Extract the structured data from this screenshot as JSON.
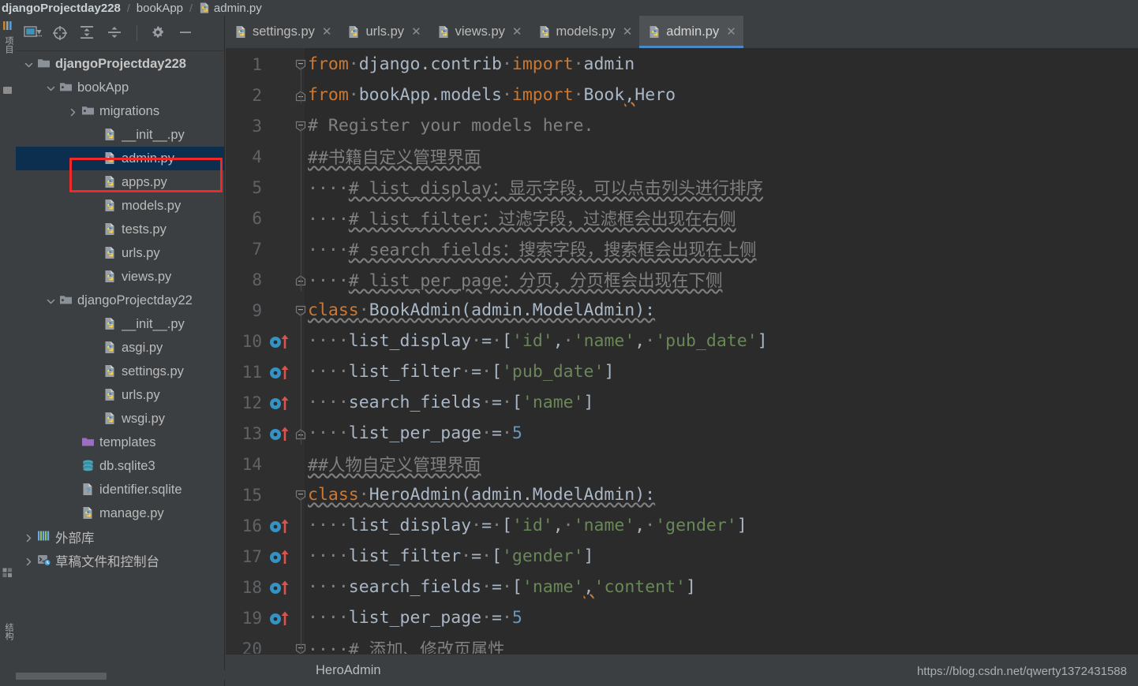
{
  "breadcrumb": {
    "segments": [
      "djangoProjectday228",
      "bookApp",
      "admin.py"
    ],
    "separator": "/"
  },
  "left_strip": {
    "top_label": "项目",
    "bottom_label": "结构"
  },
  "project_panel": {
    "toolbar": [
      {
        "name": "select-opened-file-icon",
        "label": "Select Opened File"
      },
      {
        "name": "locate-icon",
        "label": "Locate"
      },
      {
        "name": "expand-all-icon",
        "label": "Expand All"
      },
      {
        "name": "collapse-all-icon",
        "label": "Collapse All"
      },
      {
        "name": "gear-icon",
        "label": "Settings"
      },
      {
        "name": "hide-icon",
        "label": "Hide"
      }
    ],
    "tree": [
      {
        "label": "djangoProjectday228",
        "indent": 0,
        "arrow": "down",
        "icon": "folder-root",
        "bold": true,
        "selected": false
      },
      {
        "label": "bookApp",
        "indent": 1,
        "arrow": "down",
        "icon": "folder-module",
        "bold": false,
        "selected": false
      },
      {
        "label": "migrations",
        "indent": 2,
        "arrow": "right",
        "icon": "folder-module",
        "bold": false,
        "selected": false
      },
      {
        "label": "__init__.py",
        "indent": 3,
        "arrow": "none",
        "icon": "python-file",
        "bold": false,
        "selected": false
      },
      {
        "label": "admin.py",
        "indent": 3,
        "arrow": "none",
        "icon": "python-file",
        "bold": false,
        "selected": true
      },
      {
        "label": "apps.py",
        "indent": 3,
        "arrow": "none",
        "icon": "python-file",
        "bold": false,
        "selected": false
      },
      {
        "label": "models.py",
        "indent": 3,
        "arrow": "none",
        "icon": "python-file",
        "bold": false,
        "selected": false
      },
      {
        "label": "tests.py",
        "indent": 3,
        "arrow": "none",
        "icon": "python-file",
        "bold": false,
        "selected": false
      },
      {
        "label": "urls.py",
        "indent": 3,
        "arrow": "none",
        "icon": "python-file",
        "bold": false,
        "selected": false
      },
      {
        "label": "views.py",
        "indent": 3,
        "arrow": "none",
        "icon": "python-file",
        "bold": false,
        "selected": false
      },
      {
        "label": "djangoProjectday22",
        "indent": 1,
        "arrow": "down",
        "icon": "folder-module",
        "bold": false,
        "selected": false
      },
      {
        "label": "__init__.py",
        "indent": 3,
        "arrow": "none",
        "icon": "python-file",
        "bold": false,
        "selected": false
      },
      {
        "label": "asgi.py",
        "indent": 3,
        "arrow": "none",
        "icon": "python-file",
        "bold": false,
        "selected": false
      },
      {
        "label": "settings.py",
        "indent": 3,
        "arrow": "none",
        "icon": "python-file",
        "bold": false,
        "selected": false
      },
      {
        "label": "urls.py",
        "indent": 3,
        "arrow": "none",
        "icon": "python-file",
        "bold": false,
        "selected": false
      },
      {
        "label": "wsgi.py",
        "indent": 3,
        "arrow": "none",
        "icon": "python-file",
        "bold": false,
        "selected": false
      },
      {
        "label": "templates",
        "indent": 2,
        "arrow": "none",
        "icon": "folder-templates",
        "bold": false,
        "selected": false
      },
      {
        "label": "db.sqlite3",
        "indent": 2,
        "arrow": "none",
        "icon": "database",
        "bold": false,
        "selected": false
      },
      {
        "label": "identifier.sqlite",
        "indent": 2,
        "arrow": "none",
        "icon": "unknown-file",
        "bold": false,
        "selected": false
      },
      {
        "label": "manage.py",
        "indent": 2,
        "arrow": "none",
        "icon": "python-file",
        "bold": false,
        "selected": false
      },
      {
        "label": "外部库",
        "indent": 0,
        "arrow": "right",
        "icon": "library",
        "bold": false,
        "selected": false
      },
      {
        "label": "草稿文件和控制台",
        "indent": 0,
        "arrow": "right",
        "icon": "scratches",
        "bold": false,
        "selected": false
      }
    ],
    "annotation": {
      "name": "red-highlight-box",
      "color": "#ef2929",
      "target": "admin.py"
    }
  },
  "editor": {
    "tabs": [
      {
        "label": "settings.py",
        "active": false,
        "icon": "python-file"
      },
      {
        "label": "urls.py",
        "active": false,
        "icon": "python-file"
      },
      {
        "label": "views.py",
        "active": false,
        "icon": "python-file"
      },
      {
        "label": "models.py",
        "active": false,
        "icon": "python-file"
      },
      {
        "label": "admin.py",
        "active": true,
        "icon": "python-file"
      }
    ],
    "close_glyph": "✕",
    "active_tab_underline": "#4a88c7",
    "lines": [
      {
        "n": "1",
        "gutter": "none",
        "fold": "fold-start",
        "html": "<span class=\"kw\">from</span><span class=\"cm\">·</span>django.contrib<span class=\"cm\">·</span><span class=\"kw\">import</span><span class=\"cm\">·</span>admin",
        "text": "from django.contrib import admin"
      },
      {
        "n": "2",
        "gutter": "none",
        "fold": "fold-end",
        "html": "<span class=\"kw\">from</span><span class=\"cm\">·</span>bookApp.models<span class=\"cm\">·</span><span class=\"kw\">import</span><span class=\"cm\">·</span>Book<span class=\"wavy-o\">,</span>Hero",
        "text": "from bookApp.models import Book,Hero"
      },
      {
        "n": "3",
        "gutter": "none",
        "fold": "fold-start",
        "html": "<span class=\"cm\"># Register your models here.</span>",
        "text": "# Register your models here."
      },
      {
        "n": "4",
        "gutter": "none",
        "fold": "none",
        "html": "<span class=\"cm wavy\">##书籍自定义管理界面</span>",
        "text": "##书籍自定义管理界面"
      },
      {
        "n": "5",
        "gutter": "none",
        "fold": "none",
        "html": "<span class=\"cm\">····</span><span class=\"cm wavy\"># list_display：显示字段，可以点击列头进行排序</span>",
        "text": "    # list_display：显示字段，可以点击列头进行排序"
      },
      {
        "n": "6",
        "gutter": "none",
        "fold": "none",
        "html": "<span class=\"cm\">····</span><span class=\"cm wavy\"># list_filter：过滤字段，过滤框会出现在右侧</span>",
        "text": "    # list_filter：过滤字段，过滤框会出现在右侧"
      },
      {
        "n": "7",
        "gutter": "none",
        "fold": "none",
        "html": "<span class=\"cm\">····</span><span class=\"cm wavy\"># search_fields：搜索字段，搜索框会出现在上侧</span>",
        "text": "    # search_fields：搜索字段，搜索框会出现在上侧"
      },
      {
        "n": "8",
        "gutter": "none",
        "fold": "fold-end",
        "html": "<span class=\"cm\">····</span><span class=\"cm wavy\"># list_per_page：分页，分页框会出现在下侧</span>",
        "text": "    # list_per_page：分页，分页框会出现在下侧"
      },
      {
        "n": "9",
        "gutter": "none",
        "fold": "fold-start",
        "html": "<span class=\"kw wavy\">class</span><span class=\"cm wavy\">·</span><span class=\"def wavy\">BookAdmin(admin.ModelAdmin):</span>",
        "text": "class BookAdmin(admin.ModelAdmin):"
      },
      {
        "n": "10",
        "gutter": "overridden-marker",
        "fold": "none",
        "html": "<span class=\"cm\">····</span>list_display<span class=\"cm\">·</span>=<span class=\"cm\">·</span>[<span class=\"str\">'id'</span>,<span class=\"cm\">·</span><span class=\"str\">'name'</span>,<span class=\"cm\">·</span><span class=\"str\">'pub_date'</span>]",
        "text": "    list_display = ['id', 'name', 'pub_date']"
      },
      {
        "n": "11",
        "gutter": "overridden-marker",
        "fold": "none",
        "html": "<span class=\"cm\">····</span>list_filter<span class=\"cm\">·</span>=<span class=\"cm\">·</span>[<span class=\"str\">'pub_date'</span>]",
        "text": "    list_filter = ['pub_date']"
      },
      {
        "n": "12",
        "gutter": "overridden-marker",
        "fold": "none",
        "html": "<span class=\"cm\">····</span>search_fields<span class=\"cm\">·</span>=<span class=\"cm\">·</span>[<span class=\"str\">'name'</span>]",
        "text": "    search_fields = ['name']"
      },
      {
        "n": "13",
        "gutter": "overridden-marker",
        "fold": "fold-end",
        "html": "<span class=\"cm\">····</span>list_per_page<span class=\"cm\">·</span>=<span class=\"cm\">·</span><span class=\"num\">5</span>",
        "text": "    list_per_page = 5"
      },
      {
        "n": "14",
        "gutter": "none",
        "fold": "none",
        "html": "<span class=\"cm wavy\">##人物自定义管理界面</span>",
        "text": "##人物自定义管理界面"
      },
      {
        "n": "15",
        "gutter": "none",
        "fold": "fold-start",
        "html": "<span class=\"kw wavy\">class</span><span class=\"cm wavy\">·</span><span class=\"def wavy\">HeroAdmin(admin.ModelAdmin):</span>",
        "text": "class HeroAdmin(admin.ModelAdmin):"
      },
      {
        "n": "16",
        "gutter": "overridden-marker",
        "fold": "none",
        "html": "<span class=\"cm\">····</span>list_display<span class=\"cm\">·</span>=<span class=\"cm\">·</span>[<span class=\"str\">'id'</span>,<span class=\"cm\">·</span><span class=\"str\">'name'</span>,<span class=\"cm\">·</span><span class=\"str\">'gender'</span>]",
        "text": "    list_display = ['id', 'name', 'gender']"
      },
      {
        "n": "17",
        "gutter": "overridden-marker",
        "fold": "none",
        "html": "<span class=\"cm\">····</span>list_filter<span class=\"cm\">·</span>=<span class=\"cm\">·</span>[<span class=\"str\">'gender'</span>]",
        "text": "    list_filter = ['gender']"
      },
      {
        "n": "18",
        "gutter": "overridden-marker",
        "fold": "none",
        "html": "<span class=\"cm\">····</span>search_fields<span class=\"cm\">·</span>=<span class=\"cm\">·</span>[<span class=\"str\">'name'</span><span class=\"wavy-o\">,</span><span class=\"str\">'content'</span>]",
        "text": "    search_fields = ['name','content']"
      },
      {
        "n": "19",
        "gutter": "overridden-marker",
        "fold": "none",
        "html": "<span class=\"cm\">····</span>list_per_page<span class=\"cm\">·</span>=<span class=\"cm\">·</span><span class=\"num\">5</span>",
        "text": "    list_per_page = 5"
      },
      {
        "n": "20",
        "gutter": "none",
        "fold": "fold-start",
        "html": "<span class=\"cm\">····# 添加、修改页属性</span>",
        "text": "    # 添加、修改页属性"
      }
    ],
    "status_breadcrumb": "HeroAdmin"
  },
  "watermark": "https://blog.csdn.net/qwerty1372431588",
  "colors": {
    "editor_bg": "#2b2b2b",
    "panel_bg": "#3c3f41",
    "gutter_bg": "#2f2f2f",
    "selection_bg": "#0d2f4f",
    "keyword": "#cc7832",
    "string": "#6a8759",
    "comment": "#808080",
    "number": "#6897bb",
    "text": "#a9b7c6",
    "accent": "#4a88c7",
    "annotation": "#ef2929"
  }
}
